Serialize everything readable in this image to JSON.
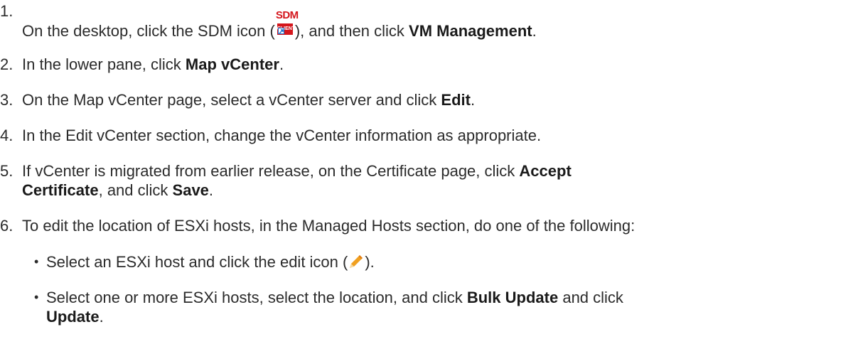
{
  "steps": [
    {
      "number": "1.",
      "parts": [
        "On the desktop, click the SDM icon (",
        "), and then click ",
        "VM Management",
        "."
      ]
    },
    {
      "number": "2.",
      "parts": [
        "In the lower pane, click ",
        "Map vCenter",
        "."
      ]
    },
    {
      "number": "3.",
      "parts": [
        "On the Map vCenter page, select a vCenter server and click ",
        "Edit",
        "."
      ]
    },
    {
      "number": "4.",
      "parts": [
        "In the Edit vCenter section, change the vCenter information as appropriate."
      ]
    },
    {
      "number": "5.",
      "parts": [
        "If vCenter is migrated from earlier release, on the Certificate page, click ",
        "Accept",
        "Certificate",
        ", and click ",
        "Save",
        "."
      ]
    },
    {
      "number": "6.",
      "parts": [
        "To edit the location of ESXi hosts, in the Managed Hosts section, do one of the following:"
      ]
    }
  ],
  "substeps": [
    {
      "bullet": "•",
      "parts": [
        "Select an ESXi host and click the edit icon (",
        ")."
      ]
    },
    {
      "bullet": "•",
      "parts": [
        "Select one or more ESXi hosts, select the location, and click ",
        "Bulk Update",
        " and click",
        "Update",
        "."
      ]
    }
  ],
  "icons": {
    "sdm_icon": {
      "name": "sdm-client-icon",
      "top_text": "SDM",
      "box_text": "CLIENT",
      "color": "#d4161c"
    },
    "edit_icon": {
      "name": "pencil-icon",
      "color": "#f0a020"
    }
  }
}
